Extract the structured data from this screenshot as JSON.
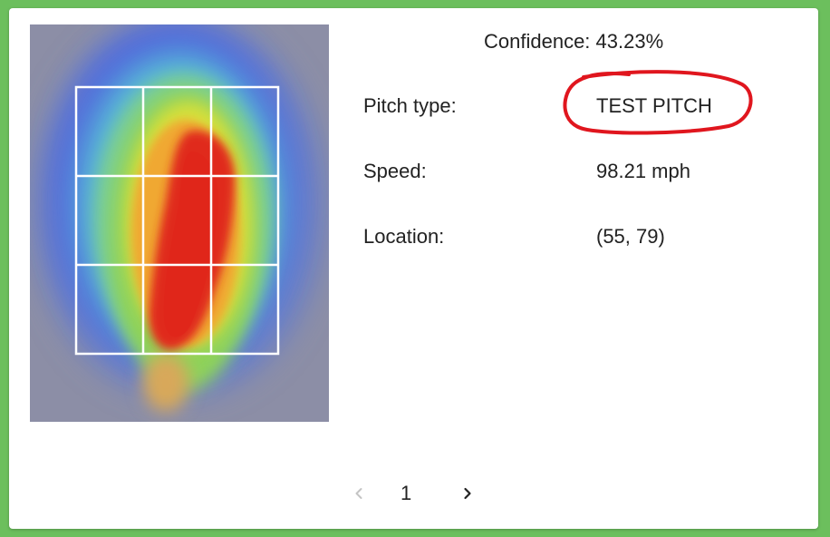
{
  "result": {
    "confidence_text": "Confidence: 43.23%",
    "rows": [
      {
        "label": "Pitch type:",
        "value": "TEST PITCH"
      },
      {
        "label": "Speed:",
        "value": "98.21 mph"
      },
      {
        "label": "Location:",
        "value": "(55, 79)"
      }
    ]
  },
  "pagination": {
    "current_page": "1",
    "prev_icon": "chevron-left-icon",
    "next_icon": "chevron-right-icon"
  },
  "colors": {
    "background": "#6cbf5d",
    "card": "#ffffff",
    "annotation": "#e0161e",
    "heat_hot": "#e02a1e",
    "heat_cold": "#4a5ad8"
  }
}
